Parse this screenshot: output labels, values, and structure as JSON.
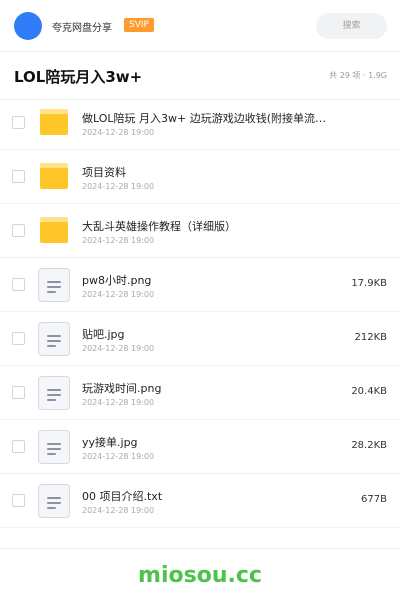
{
  "header": {
    "username": "夸克网盘分享",
    "badge": "SVIP",
    "search_placeholder": "搜索"
  },
  "title": {
    "text": "LOL陪玩月入3w+",
    "meta": "共 29 项 · 1.9G"
  },
  "items": [
    {
      "name": "做LOL陪玩 月入3w+ 边玩游戏边收钱(附接单流…",
      "date": "2024-12-28 19:00",
      "size": "",
      "type": "folder-icon"
    },
    {
      "name": "项目资料",
      "date": "2024-12-28 19:00",
      "size": "",
      "type": "folder-icon"
    },
    {
      "name": "大乱斗英雄操作教程（详细版）",
      "date": "2024-12-28 19:00",
      "size": "",
      "type": "folder-icon"
    },
    {
      "name": "pw8小时.png",
      "date": "2024-12-28 19:00",
      "size": "17.9KB",
      "type": "file-icon"
    },
    {
      "name": "贴吧.jpg",
      "date": "2024-12-28 19:00",
      "size": "212KB",
      "type": "file-icon"
    },
    {
      "name": "玩游戏时间.png",
      "date": "2024-12-28 19:00",
      "size": "20.4KB",
      "type": "file-icon"
    },
    {
      "name": "yy接单.jpg",
      "date": "2024-12-28 19:00",
      "size": "28.2KB",
      "type": "file-icon"
    },
    {
      "name": "00 项目介绍.txt",
      "date": "2024-12-28 19:00",
      "size": "677B",
      "type": "file-icon"
    }
  ],
  "footer": {
    "brand": "miosou.cc"
  },
  "colors": {
    "accent": "#2f7cf6",
    "badge": "#ff9a2e",
    "folder": "#ffc62a",
    "brand": "#4ec14e"
  }
}
